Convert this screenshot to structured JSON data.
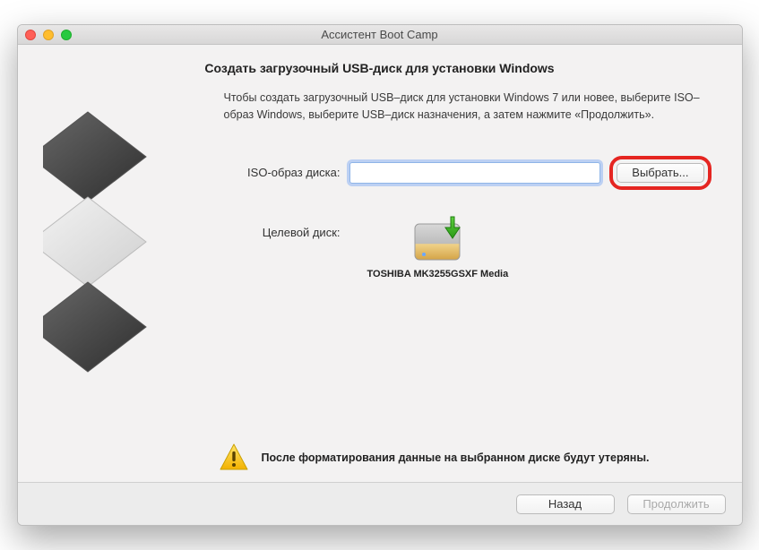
{
  "window": {
    "title": "Ассистент Boot Camp"
  },
  "heading": "Создать загрузочный USB-диск для установки Windows",
  "instructions": "Чтобы создать загрузочный USB–диск для установки Windows 7 или новее, выберите ISO–образ Windows, выберите USB–диск назначения, а затем нажмите «Продолжить».",
  "iso": {
    "label": "ISO-образ диска:",
    "value": "",
    "choose_label": "Выбрать..."
  },
  "target": {
    "label": "Целевой диск:",
    "disk_name": "TOSHIBA MK3255GSXF Media"
  },
  "warning": "После форматирования данные на выбранном диске будут утеряны.",
  "footer": {
    "back_label": "Назад",
    "continue_label": "Продолжить"
  }
}
